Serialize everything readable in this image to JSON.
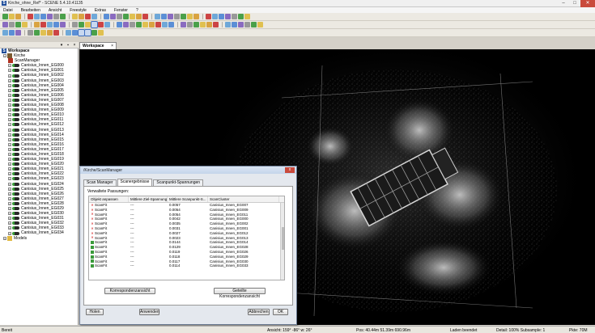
{
  "window": {
    "title": "Kirche_ohne_Ref* - SCENE 5.4.10.41135",
    "app_icon": "S"
  },
  "menu": [
    "Datei",
    "Bearbeiten",
    "Ansicht",
    "Freestyle",
    "Extras",
    "Fenster",
    "?"
  ],
  "workspace_panel": {
    "root_label": "Workspace",
    "kirche_label": "Kirche",
    "scanmanager_label": "ScanManager",
    "models_label": "Models",
    "scans": [
      "Canisius_Innen_EG000",
      "Canisius_Innen_EG001",
      "Canisius_Innen_EG002",
      "Canisius_Innen_EG003",
      "Canisius_Innen_EG004",
      "Canisius_Innen_EG005",
      "Canisius_Innen_EG006",
      "Canisius_Innen_EG007",
      "Canisius_Innen_EG008",
      "Canisius_Innen_EG009",
      "Canisius_Innen_EG010",
      "Canisius_Innen_EG011",
      "Canisius_Innen_EG012",
      "Canisius_Innen_EG013",
      "Canisius_Innen_EG014",
      "Canisius_Innen_EG015",
      "Canisius_Innen_EG016",
      "Canisius_Innen_EG017",
      "Canisius_Innen_EG018",
      "Canisius_Innen_EG019",
      "Canisius_Innen_EG020",
      "Canisius_Innen_EG021",
      "Canisius_Innen_EG022",
      "Canisius_Innen_EG023",
      "Canisius_Innen_EG024",
      "Canisius_Innen_EG025",
      "Canisius_Innen_EG026",
      "Canisius_Innen_EG027",
      "Canisius_Innen_EG028",
      "Canisius_Innen_EG029",
      "Canisius_Innen_EG030",
      "Canisius_Innen_EG031",
      "Canisius_Innen_EG032",
      "Canisius_Innen_EG033",
      "Canisius_Innen_EG034"
    ]
  },
  "workspace_tab": {
    "label": "Workspace",
    "close": "×"
  },
  "dialog": {
    "title": "/Kirche/ScanManager",
    "tabs": [
      "Scan Manager",
      "Scanergebnisse",
      "Scanpunkt-Spannungen"
    ],
    "active_tab": 1,
    "group_label": "Verwaltete Passungen:",
    "columns": [
      "Objekt anpassen",
      "Mittlere Ziel-Spannung",
      "Mittlere Scanpunkt-S...",
      "ScanCluster"
    ],
    "rows": [
      {
        "status": "bad",
        "obj": "ScanFit",
        "ziel": "---",
        "scan": "0.0057",
        "cluster": "Canisius_Innen_EG007"
      },
      {
        "status": "bad",
        "obj": "ScanFit",
        "ziel": "---",
        "scan": "0.0054",
        "cluster": "Canisius_Innen_EG009"
      },
      {
        "status": "bad",
        "obj": "ScanFit",
        "ziel": "---",
        "scan": "0.0054",
        "cluster": "Canisius_Innen_EG011"
      },
      {
        "status": "bad",
        "obj": "ScanFit",
        "ziel": "---",
        "scan": "0.0042",
        "cluster": "Canisius_Innen_EG000"
      },
      {
        "status": "bad",
        "obj": "ScanFit",
        "ziel": "---",
        "scan": "0.0035",
        "cluster": "Canisius_Innen_EG002"
      },
      {
        "status": "bad",
        "obj": "ScanFit",
        "ziel": "---",
        "scan": "0.0031",
        "cluster": "Canisius_Innen_EG001"
      },
      {
        "status": "bad",
        "obj": "ScanFit",
        "ziel": "---",
        "scan": "0.0027",
        "cluster": "Canisius_Innen_EG012"
      },
      {
        "status": "bad",
        "obj": "ScanFit",
        "ziel": "---",
        "scan": "0.0023",
        "cluster": "Canisius_Innen_EG013"
      },
      {
        "status": "good",
        "obj": "ScanFit",
        "ziel": "---",
        "scan": "0.0144",
        "cluster": "Canisius_Innen_EG014"
      },
      {
        "status": "good",
        "obj": "ScanFit",
        "ziel": "---",
        "scan": "0.0129",
        "cluster": "Canisius_Innen_EG028"
      },
      {
        "status": "good",
        "obj": "ScanFit",
        "ziel": "---",
        "scan": "0.0119",
        "cluster": "Canisius_Innen_EG026"
      },
      {
        "status": "good",
        "obj": "ScanFit",
        "ziel": "---",
        "scan": "0.0118",
        "cluster": "Canisius_Innen_EG029"
      },
      {
        "status": "good",
        "obj": "ScanFit",
        "ziel": "---",
        "scan": "0.0117",
        "cluster": "Canisius_Innen_EG030"
      },
      {
        "status": "good",
        "obj": "ScanFit",
        "ziel": "---",
        "scan": "0.0114",
        "cluster": "Canisius_Innen_EG033"
      }
    ],
    "btn_korrespondenz": "Korrespondenzansicht",
    "btn_geteilt": "Geteilte Korrespondenzansicht",
    "btn_holen": "Holen",
    "btn_anwenden": "Anwenden",
    "btn_abbrechen": "Abbrechen",
    "btn_ok": "OK",
    "close": "x"
  },
  "status": {
    "ready": "Bereit",
    "view": "Ansicht: 159° -86° w: 26°",
    "pos": "Pos: 40.44m 51.39m 690.96m",
    "load": "Laden beendet",
    "detail": "Detail: 100% Subsample: 1",
    "ram": "Pkte: 70M"
  },
  "colors": {
    "accent": "#3a9a3a",
    "bad": "#cc0000"
  }
}
